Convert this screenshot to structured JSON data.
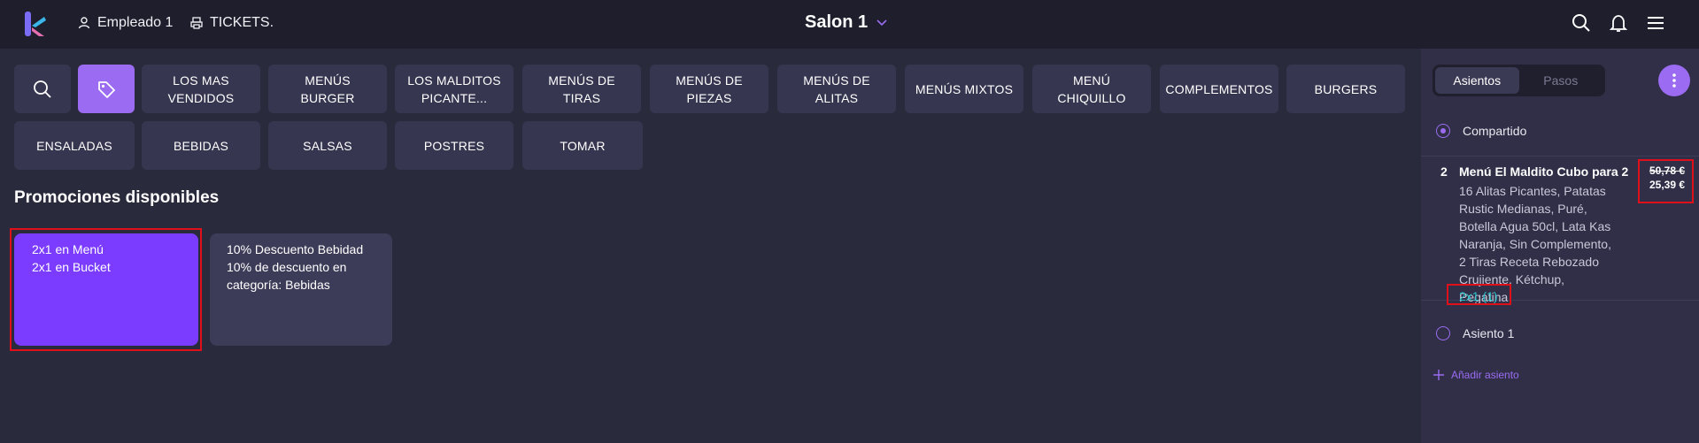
{
  "header": {
    "user_label": "Empleado 1",
    "tickets_label": "TICKETS.",
    "salon_title": "Salon 1",
    "icons": [
      "search-icon",
      "bell-icon",
      "menu-icon"
    ],
    "accent_color": "#9b6cf2"
  },
  "categories": {
    "row1": [
      "LOS MAS VENDIDOS",
      "MENÚS BURGER",
      "LOS MALDITOS PICANTE...",
      "MENÚS DE TIRAS",
      "MENÚS DE PIEZAS",
      "MENÚS DE ALITAS",
      "MENÚS MIXTOS",
      "MENÚ CHIQUILLO",
      "COMPLEMENTOS",
      "BURGERS"
    ],
    "row2": [
      "ENSALADAS",
      "BEBIDAS",
      "SALSAS",
      "POSTRES",
      "TOMAR"
    ]
  },
  "promotions": {
    "title": "Promociones disponibles",
    "cards": [
      {
        "line1": "2x1 en Menú",
        "line2": "2x1 en Bucket"
      },
      {
        "line1": "10% Descuento Bebidad",
        "line2": "10% de descuento en categoría: Bebidas"
      }
    ]
  },
  "panel": {
    "tab_active": "Asientos",
    "tab_inactive": "Pasos",
    "seat_shared": "Compartido",
    "seat_1": "Asiento 1",
    "add_seat": "Añadir asiento",
    "item": {
      "qty": "2",
      "name": "Menú El Maldito Cubo para 2",
      "description": "16 Alitas Picantes, Patatas Rustic Medianas, Puré, Botella Agua 50cl, Lata Kas Naranja, Sin Complemento, 2 Tiras Receta Rebozado Crujiente, Kétchup, Pegatina",
      "promo": "2x1 (1)",
      "price_old": "50,78 €",
      "price_new": "25,39 €"
    }
  }
}
